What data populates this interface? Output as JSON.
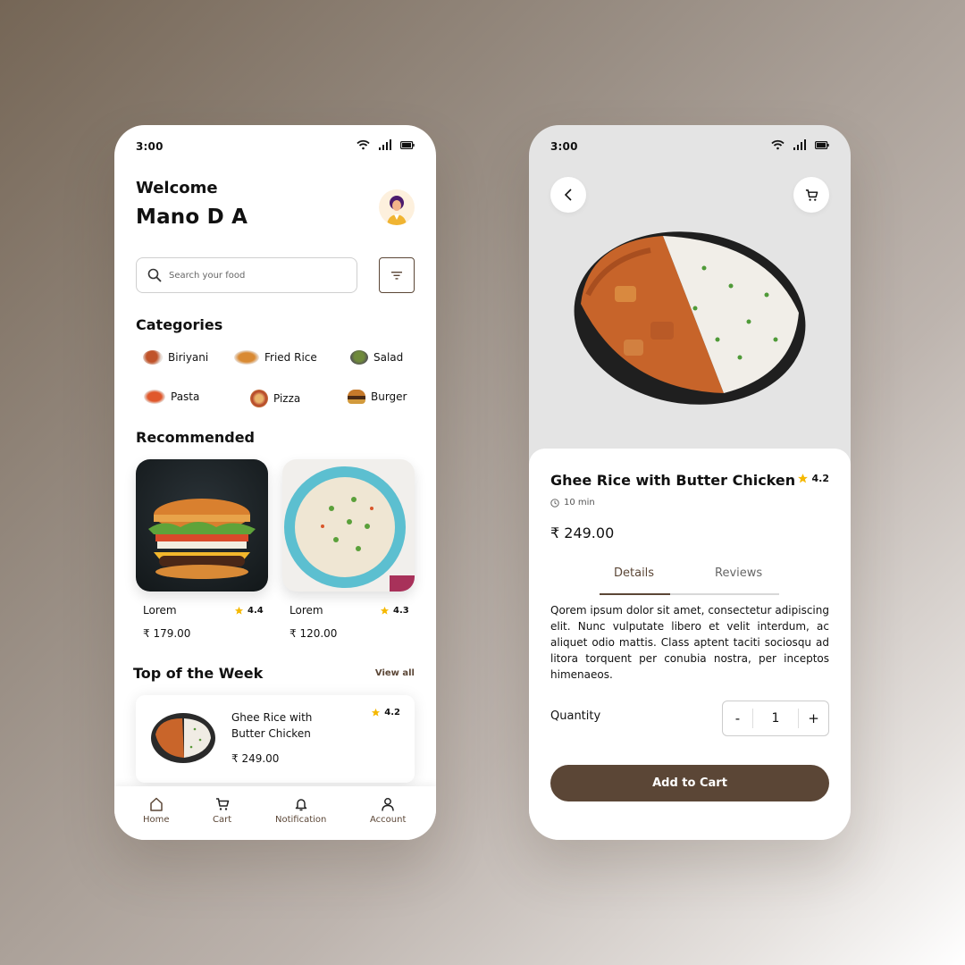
{
  "status_bar": {
    "time": "3:00"
  },
  "home": {
    "welcome": "Welcome",
    "username": "Mano D A",
    "search": {
      "placeholder": "Search your food",
      "value": ""
    },
    "categories_title": "Categories",
    "categories": [
      {
        "label": "Biriyani"
      },
      {
        "label": "Fried Rice"
      },
      {
        "label": "Salad"
      },
      {
        "label": "Pasta"
      },
      {
        "label": "Pizza"
      },
      {
        "label": "Burger"
      }
    ],
    "recommended_title": "Recommended",
    "recommended": [
      {
        "name": "Lorem",
        "rating": "4.4",
        "price": "₹ 179.00",
        "image": "burger"
      },
      {
        "name": "Lorem",
        "rating": "4.3",
        "price": "₹ 120.00",
        "image": "fried-rice-bowl"
      }
    ],
    "top_week_title": "Top of the Week",
    "view_all": "View all",
    "top_item": {
      "name": "Ghee Rice with Butter Chicken",
      "rating": "4.2",
      "price": "₹ 249.00"
    },
    "nav": [
      {
        "label": "Home",
        "icon": "home-icon"
      },
      {
        "label": "Cart",
        "icon": "cart-icon"
      },
      {
        "label": "Notification",
        "icon": "bell-icon"
      },
      {
        "label": "Account",
        "icon": "user-icon"
      }
    ]
  },
  "detail": {
    "title": "Ghee Rice with Butter Chicken",
    "rating": "4.2",
    "time": "10 min",
    "price": "₹ 249.00",
    "tabs": [
      {
        "label": "Details",
        "active": true
      },
      {
        "label": "Reviews",
        "active": false
      }
    ],
    "description": "Qorem ipsum dolor sit amet, consectetur adipiscing elit. Nunc vulputate libero et velit interdum, ac aliquet odio mattis. Class aptent taciti sociosqu ad litora torquent per conubia nostra, per inceptos himenaeos.",
    "quantity_label": "Quantity",
    "quantity": {
      "minus": "-",
      "value": "1",
      "plus": "+"
    },
    "add_to_cart": "Add to Cart"
  },
  "colors": {
    "accent": "#5b4636",
    "star": "#f5b800",
    "hero_bg": "#e4e4e4"
  }
}
